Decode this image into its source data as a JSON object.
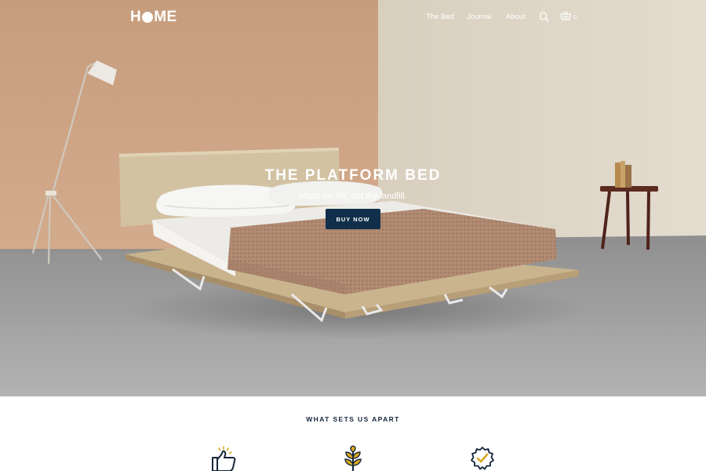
{
  "header": {
    "logo": {
      "left": "H",
      "right": "ME"
    },
    "nav": [
      {
        "label": "The Bed"
      },
      {
        "label": "Journal"
      },
      {
        "label": "About"
      }
    ],
    "search_icon": "search-icon",
    "cart_icon": "cart-icon",
    "cart_count": "0"
  },
  "hero": {
    "title": "THE PLATFORM BED",
    "subtitle": "Made for life, not the landfill.",
    "cta_label": "BUY NOW"
  },
  "features": {
    "title": "WHAT SETS US APART",
    "icons": [
      "thumbs-up-icon",
      "plant-icon",
      "badge-check-icon"
    ]
  },
  "colors": {
    "wall_left": "#c9a081",
    "wall_right": "#ddd3c3",
    "floor": "#9b9b9b",
    "blanket": "#b48d76",
    "button": "#0f2f4a",
    "feature_blue": "#15263b",
    "feature_gold": "#d9a81e"
  }
}
